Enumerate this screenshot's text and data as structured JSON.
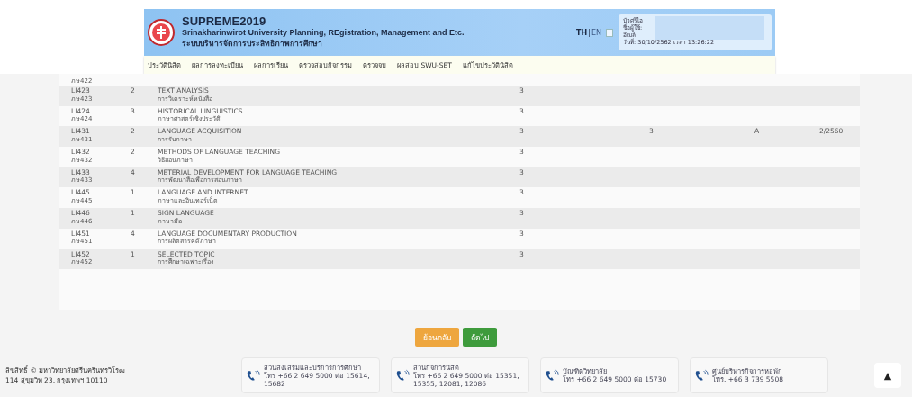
{
  "header": {
    "title": "SUPREME2019",
    "subtitle": "Srinakharinwirot University Planning, REgistration, Management and Etc.",
    "subtitle_th": "ระบบบริหารจัดการประสิทธิภาพการศึกษา",
    "languages": [
      {
        "label": "TH",
        "selected": true
      },
      {
        "label": "EN",
        "selected": false
      }
    ],
    "language_separator": "|",
    "user_labels": [
      "บัวศรีไอ",
      "ชื่อผู้ใช้:",
      "อีเมล์"
    ],
    "datetime": "วันที่: 30/10/2562 เวลา 13:26:22"
  },
  "nav": [
    "ประวัตินิสิต",
    "ผลการลงทะเบียน",
    "ผลการเรียน",
    "ตรวจสอบกิจกรรม",
    "ตรวจจบ",
    "ผลสอบ SWU-SET",
    "แก้ไขประวัตินิสิต"
  ],
  "table": {
    "rows": [
      {
        "code": "",
        "code_th": "ภษ422",
        "section": "",
        "title_en": "",
        "title_th": "",
        "credits": "",
        "column_6": "",
        "grade": "",
        "term": "",
        "partial": true
      },
      {
        "code": "LI423",
        "code_th": "ภษ423",
        "section": "2",
        "title_en": "TEXT ANALYSIS",
        "title_th": "การวิเคราะห์หนังสือ",
        "credits": "3",
        "column_6": "",
        "grade": "",
        "term": ""
      },
      {
        "code": "LI424",
        "code_th": "ภษ424",
        "section": "3",
        "title_en": "HISTORICAL LINGUISTICS",
        "title_th": "ภาษาศาสตร์เชิงประวัติ",
        "credits": "3",
        "column_6": "",
        "grade": "",
        "term": ""
      },
      {
        "code": "LI431",
        "code_th": "ภษ431",
        "section": "2",
        "title_en": "LANGUAGE ACQUISITION",
        "title_th": "การรับภาษา",
        "credits": "3",
        "column_6": "3",
        "grade": "A",
        "term": "2/2560"
      },
      {
        "code": "LI432",
        "code_th": "ภษ432",
        "section": "2",
        "title_en": "METHODS OF LANGUAGE TEACHING",
        "title_th": "วิธีสอนภาษา",
        "credits": "3",
        "column_6": "",
        "grade": "",
        "term": ""
      },
      {
        "code": "LI433",
        "code_th": "ภษ433",
        "section": "4",
        "title_en": "METERIAL DEVELOPMENT FOR LANGUAGE TEACHING",
        "title_th": "การพัฒนาสื่อเพื่อการสอนภาษา",
        "credits": "3",
        "column_6": "",
        "grade": "",
        "term": ""
      },
      {
        "code": "LI445",
        "code_th": "ภษ445",
        "section": "1",
        "title_en": "LANGUAGE AND INTERNET",
        "title_th": "ภาษาและอินเทอร์เน็ต",
        "credits": "3",
        "column_6": "",
        "grade": "",
        "term": ""
      },
      {
        "code": "LI446",
        "code_th": "ภษ446",
        "section": "1",
        "title_en": "SIGN LANGUAGE",
        "title_th": "ภาษามือ",
        "credits": "3",
        "column_6": "",
        "grade": "",
        "term": ""
      },
      {
        "code": "LI451",
        "code_th": "ภษ451",
        "section": "4",
        "title_en": "LANGUAGE DOCUMENTARY PRODUCTION",
        "title_th": "การผลิตสารคดีภาษา",
        "credits": "3",
        "column_6": "",
        "grade": "",
        "term": ""
      },
      {
        "code": "LI452",
        "code_th": "ภษ452",
        "section": "1",
        "title_en": "SELECTED TOPIC",
        "title_th": "การศึกษาเฉพาะเรื่อง",
        "credits": "3",
        "column_6": "",
        "grade": "",
        "term": ""
      }
    ]
  },
  "buttons": [
    {
      "label": "ย้อนกลับ",
      "kind": "back"
    },
    {
      "label": "ถัดไป",
      "kind": "next"
    }
  ],
  "footer": {
    "copyright": "ลิขสิทธิ์ © มหาวิทยาลัยศรีนครินทรวิโรฒ",
    "address": "114 สุขุมวิท 23, กรุงเทพฯ 10110",
    "contacts": [
      {
        "name": "ส่วนส่งเสริมและบริการการศึกษา",
        "phone": "โทร +66 2 649 5000 ต่อ 15614, 15682"
      },
      {
        "name": "ส่วนกิจการนิสิต",
        "phone": "โทร +66 2 649 5000 ต่อ 15351, 15355, 12081, 12086"
      },
      {
        "name": "บัณฑิตวิทยาลัย",
        "phone": "โทร +66 2 649 5000 ต่อ 15730"
      },
      {
        "name": "ศูนย์บริหารกิจการหอพัก",
        "phone": "โทร. +66 3 739 5508"
      }
    ],
    "scroll_top": "▲"
  }
}
